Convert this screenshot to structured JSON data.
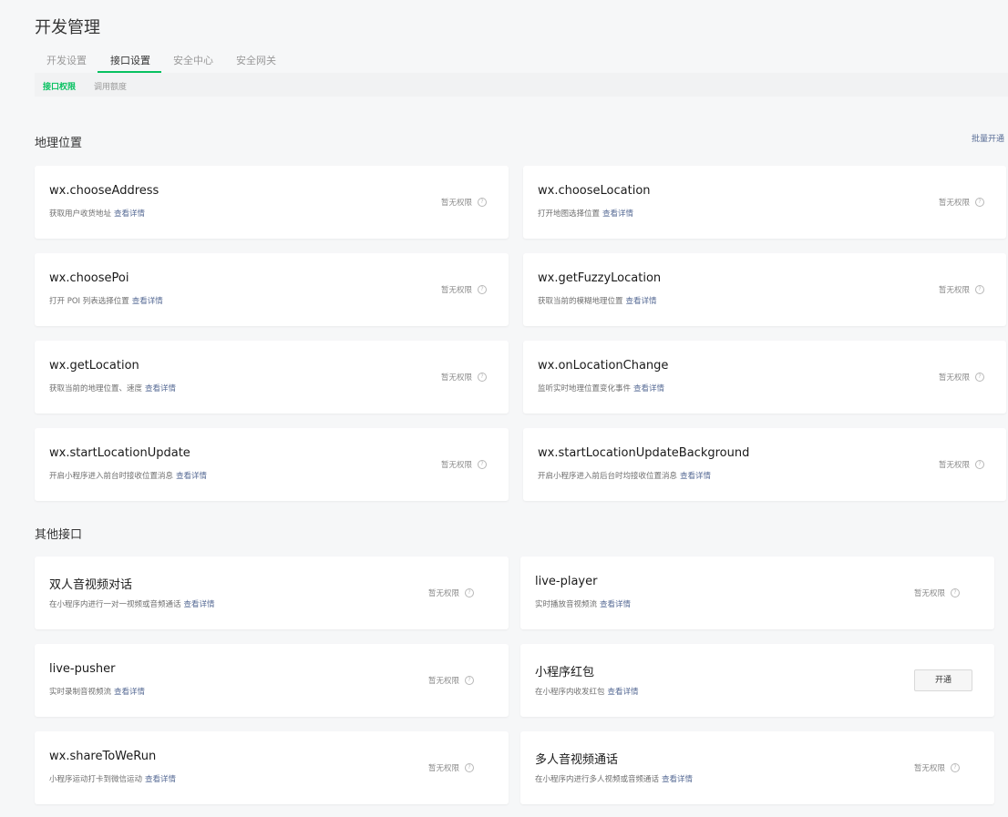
{
  "page_title": "开发管理",
  "tabs": [
    {
      "label": "开发设置"
    },
    {
      "label": "接口设置"
    },
    {
      "label": "安全中心"
    },
    {
      "label": "安全网关"
    }
  ],
  "subtabs": [
    {
      "label": "接口权限"
    },
    {
      "label": "调用额度"
    }
  ],
  "sections": {
    "geo": {
      "title": "地理位置",
      "batch_label": "批量开通",
      "cards": [
        {
          "name": "wx.chooseAddress",
          "desc": "获取用户收货地址",
          "link": "查看详情",
          "status": "暂无权限"
        },
        {
          "name": "wx.chooseLocation",
          "desc": "打开地图选择位置",
          "link": "查看详情",
          "status": "暂无权限"
        },
        {
          "name": "wx.choosePoi",
          "desc": "打开 POI 列表选择位置",
          "link": "查看详情",
          "status": "暂无权限"
        },
        {
          "name": "wx.getFuzzyLocation",
          "desc": "获取当前的模糊地理位置",
          "link": "查看详情",
          "status": "暂无权限"
        },
        {
          "name": "wx.getLocation",
          "desc": "获取当前的地理位置、速度",
          "link": "查看详情",
          "status": "暂无权限"
        },
        {
          "name": "wx.onLocationChange",
          "desc": "监听实时地理位置变化事件",
          "link": "查看详情",
          "status": "暂无权限"
        },
        {
          "name": "wx.startLocationUpdate",
          "desc": "开启小程序进入前台时接收位置消息",
          "link": "查看详情",
          "status": "暂无权限"
        },
        {
          "name": "wx.startLocationUpdateBackground",
          "desc": "开启小程序进入前后台时均接收位置消息",
          "link": "查看详情",
          "status": "暂无权限"
        }
      ]
    },
    "other": {
      "title": "其他接口",
      "cards": [
        {
          "name": "双人音视频对话",
          "desc": "在小程序内进行一对一视频或音频通话",
          "link": "查看详情",
          "status": "暂无权限"
        },
        {
          "name": "live-player",
          "desc": "实时播放音视频流",
          "link": "查看详情",
          "status": "暂无权限"
        },
        {
          "name": "live-pusher",
          "desc": "实时录制音视频流",
          "link": "查看详情",
          "status": "暂无权限"
        },
        {
          "name": "小程序红包",
          "desc": "在小程序内收发红包",
          "link": "查看详情",
          "button": "开通"
        },
        {
          "name": "wx.shareToWeRun",
          "desc": "小程序运动打卡到微信运动",
          "link": "查看详情",
          "status": "暂无权限"
        },
        {
          "name": "多人音视频通话",
          "desc": "在小程序内进行多人视频或音频通话",
          "link": "查看详情",
          "status": "暂无权限"
        }
      ]
    }
  }
}
